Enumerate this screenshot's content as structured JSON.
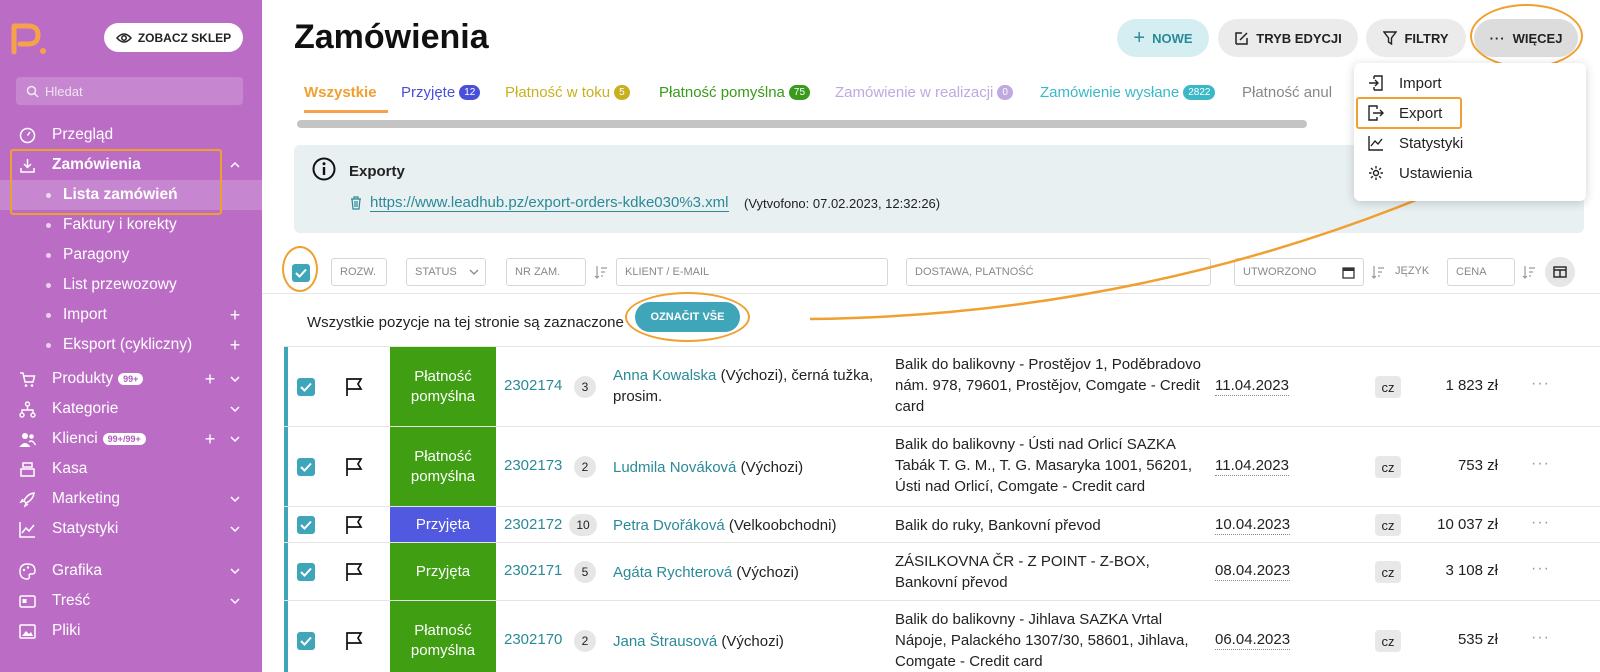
{
  "sidebar": {
    "shop_button": "ZOBACZ SKLEP",
    "search_placeholder": "Hledat",
    "items": [
      {
        "label": "Przegląd"
      },
      {
        "label": "Zamówienia"
      },
      {
        "label": "Lista zamówień"
      },
      {
        "label": "Faktury i korekty"
      },
      {
        "label": "Paragony"
      },
      {
        "label": "List przewozowy"
      },
      {
        "label": "Import"
      },
      {
        "label": "Eksport (cykliczny)"
      },
      {
        "label": "Produkty",
        "badge": "99+"
      },
      {
        "label": "Kategorie"
      },
      {
        "label": "Klienci",
        "badge": "99+/99+"
      },
      {
        "label": "Kasa"
      },
      {
        "label": "Marketing"
      },
      {
        "label": "Statystyki"
      },
      {
        "label": "Grafika"
      },
      {
        "label": "Treść"
      },
      {
        "label": "Pliki"
      }
    ]
  },
  "header": {
    "title": "Zamówienia",
    "buttons": {
      "new": "NOWE",
      "edit_mode": "TRYB EDYCJI",
      "filters": "FILTRY",
      "more": "WIĘCEJ"
    }
  },
  "tabs": [
    {
      "label": "Wszystkie",
      "color": "#f0a030"
    },
    {
      "label": "Przyjęte",
      "count": "12",
      "color": "#4a4fd8"
    },
    {
      "label": "Płatność w toku",
      "count": "5",
      "color": "#c8b020"
    },
    {
      "label": "Płatność pomyślna",
      "count": "75",
      "color": "#3a9a1a"
    },
    {
      "label": "Zamówienie w realizacji",
      "count": "0",
      "color": "#c0a8e0"
    },
    {
      "label": "Zamówienie wysłane",
      "count": "2822",
      "color": "#3ab8c8"
    },
    {
      "label": "Płatność anul",
      "color": "#888888"
    }
  ],
  "more_menu": [
    {
      "label": "Import",
      "icon": "import-icon"
    },
    {
      "label": "Export",
      "icon": "export-icon"
    },
    {
      "label": "Statystyki",
      "icon": "chart-icon"
    },
    {
      "label": "Ustawienia",
      "icon": "gear-icon"
    }
  ],
  "exports": {
    "title": "Exporty",
    "link": "https://www.leadhub.pz/export-orders-kdke030%3.xml",
    "created": "(Vytvofono: 07.02.2023, 12:32:26)"
  },
  "filters": {
    "rozw": "ROZW.",
    "status": "STATUS",
    "order_no": "NR ZAM.",
    "client": "KLIENT / E-MAIL",
    "shipping": "DOSTAWA, PLATNOŚĆ",
    "created": "UTWORZONO",
    "language": "JĘZYK",
    "price": "CENA"
  },
  "selection": {
    "text": "Wszystkie pozycje na tej stronie są zaznaczone",
    "mark_all": "OZNAČIT VŠE"
  },
  "orders": [
    {
      "status": "Płatność pomyślna",
      "status_color": "#3f9e12",
      "id": "2302174",
      "items": "3",
      "customer": "Anna Kowalska",
      "customer_note": " (Výchozi), černá tužka, prosim.",
      "shipping": "Balik do balikovny - Prostějov 1, Poděbradovo nám. 978, 79601, Prostějov, Comgate - Credit card",
      "date": "11.04.2023",
      "lang": "cz",
      "price": "1 823 zł"
    },
    {
      "status": "Płatność pomyślna",
      "status_color": "#3f9e12",
      "id": "2302173",
      "items": "2",
      "customer": "Ludmila Nováková",
      "customer_note": " (Výchozi)",
      "shipping": "Balik do balikovny - Ústi nad Orlicí SAZKA Tabák T. G. M., T. G. Masaryka 1001, 56201, Ústi nad Orlicí, Comgate - Credit card",
      "date": "11.04.2023",
      "lang": "cz",
      "price": "753 zł"
    },
    {
      "status": "Przyjęta",
      "status_color": "#5059e0",
      "id": "2302172",
      "items": "10",
      "customer": "Petra Dvořáková",
      "customer_note": " (Velkoobchodni)",
      "shipping": "Balik do ruky, Bankovní převod",
      "date": "10.04.2023",
      "lang": "cz",
      "price": "10 037 zł"
    },
    {
      "status": "Przyjęta",
      "status_color": "#3f9e12",
      "id": "2302171",
      "items": "5",
      "customer": "Agáta Rychterová",
      "customer_note": " (Výchozi)",
      "shipping": "ZÁSILKOVNA ČR - Z POINT - Z-BOX, Bankovní převod",
      "date": "08.04.2023",
      "lang": "cz",
      "price": "3 108 zł"
    },
    {
      "status": "Płatność pomyślna",
      "status_color": "#3f9e12",
      "id": "2302170",
      "items": "2",
      "customer": "Jana Štrausová",
      "customer_note": " (Výchozi)",
      "shipping": "Balik do balikovny - Jihlava SAZKA Vrtal Nápoje, Palackého 1307/30, 58601, Jihlava, Comgate - Credit card",
      "date": "06.04.2023",
      "lang": "cz",
      "price": "535 zł"
    }
  ],
  "colors": {
    "sidebar": "#bb6dc6",
    "accent": "#3fa5b8",
    "highlight": "#f0a030"
  }
}
